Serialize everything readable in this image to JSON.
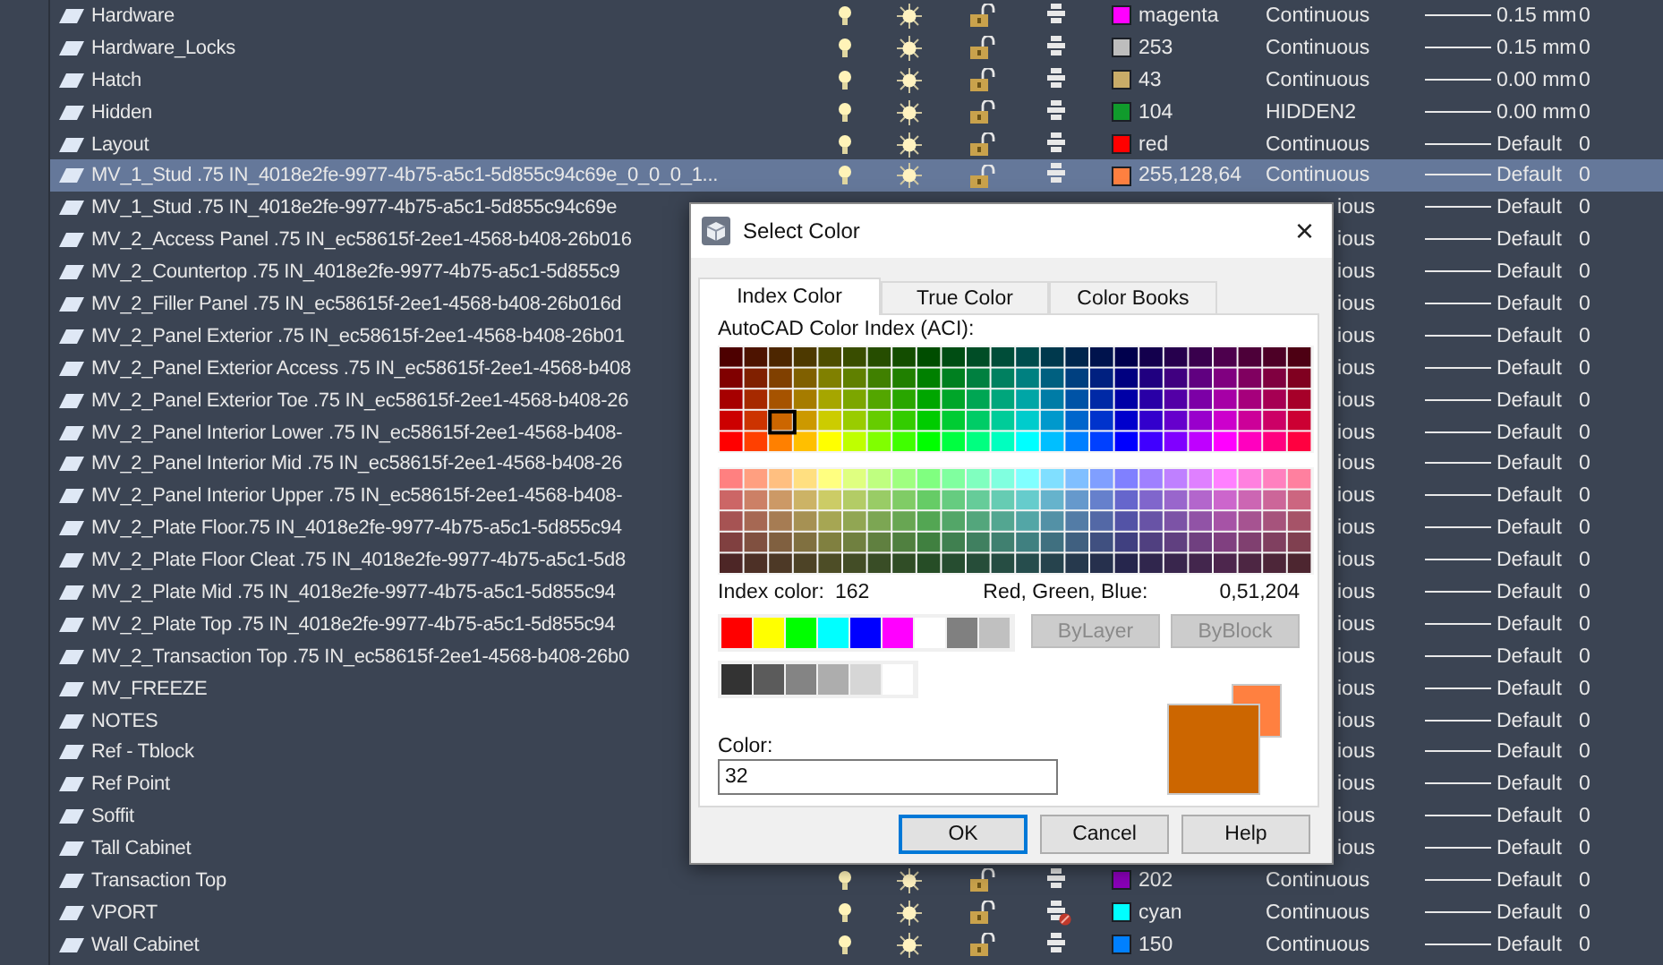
{
  "layers": [
    {
      "kind": "full",
      "name": "Hardware",
      "on": true,
      "frozen": false,
      "locked": false,
      "plot": true,
      "color": "#ff00ff",
      "color_name": "magenta",
      "linetype": "Continuous",
      "lineweight": "0.15 mm",
      "transparency": "0",
      "selected": false
    },
    {
      "kind": "full",
      "name": "Hardware_Locks",
      "on": true,
      "frozen": false,
      "locked": false,
      "plot": true,
      "color": "#bdbdbd",
      "color_name": "253",
      "linetype": "Continuous",
      "lineweight": "0.15 mm",
      "transparency": "0",
      "selected": false
    },
    {
      "kind": "full",
      "name": "Hatch",
      "on": true,
      "frozen": false,
      "locked": false,
      "plot": true,
      "color": "#c9ac68",
      "color_name": "43",
      "linetype": "Continuous",
      "lineweight": "0.00 mm",
      "transparency": "0",
      "selected": false
    },
    {
      "kind": "full",
      "name": "Hidden",
      "on": true,
      "frozen": false,
      "locked": false,
      "plot": true,
      "color": "#109b2c",
      "color_name": "104",
      "linetype": "HIDDEN2",
      "lineweight": "0.00 mm",
      "transparency": "0",
      "selected": false
    },
    {
      "kind": "full",
      "name": "Layout",
      "on": true,
      "frozen": false,
      "locked": false,
      "plot": true,
      "color": "#ff0000",
      "color_name": "red",
      "linetype": "Continuous",
      "lineweight": "Default",
      "transparency": "0",
      "selected": false
    },
    {
      "kind": "full",
      "name": "MV_1_Stud .75 IN_4018e2fe-9977-4b75-a5c1-5d855c94c69e_0_0_0_1...",
      "on": true,
      "frozen": false,
      "locked": false,
      "plot": true,
      "color": "#ff8040",
      "color_name": "255,128,64",
      "linetype": "Continuous",
      "lineweight": "Default",
      "transparency": "0",
      "selected": true
    },
    {
      "kind": "covered",
      "name": "MV_1_Stud .75 IN_4018e2fe-9977-4b75-a5c1-5d855c94c69e",
      "linetype": "ious",
      "lineweight": "Default",
      "transparency": "0"
    },
    {
      "kind": "covered",
      "name": "MV_2_Access Panel .75 IN_ec58615f-2ee1-4568-b408-26b016",
      "linetype": "ious",
      "lineweight": "Default",
      "transparency": "0"
    },
    {
      "kind": "covered",
      "name": "MV_2_Countertop .75 IN_4018e2fe-9977-4b75-a5c1-5d855c9",
      "linetype": "ious",
      "lineweight": "Default",
      "transparency": "0"
    },
    {
      "kind": "covered",
      "name": "MV_2_Filler Panel .75 IN_ec58615f-2ee1-4568-b408-26b016d",
      "linetype": "ious",
      "lineweight": "Default",
      "transparency": "0"
    },
    {
      "kind": "covered",
      "name": "MV_2_Panel Exterior .75 IN_ec58615f-2ee1-4568-b408-26b01",
      "linetype": "ious",
      "lineweight": "Default",
      "transparency": "0"
    },
    {
      "kind": "covered",
      "name": "MV_2_Panel Exterior Access .75 IN_ec58615f-2ee1-4568-b408",
      "linetype": "ious",
      "lineweight": "Default",
      "transparency": "0"
    },
    {
      "kind": "covered",
      "name": "MV_2_Panel Exterior Toe .75 IN_ec58615f-2ee1-4568-b408-26",
      "linetype": "ious",
      "lineweight": "Default",
      "transparency": "0"
    },
    {
      "kind": "covered",
      "name": "MV_2_Panel Interior Lower .75 IN_ec58615f-2ee1-4568-b408-",
      "linetype": "ious",
      "lineweight": "Default",
      "transparency": "0"
    },
    {
      "kind": "covered",
      "name": "MV_2_Panel Interior Mid .75 IN_ec58615f-2ee1-4568-b408-26",
      "linetype": "ious",
      "lineweight": "Default",
      "transparency": "0"
    },
    {
      "kind": "covered",
      "name": "MV_2_Panel Interior Upper .75 IN_ec58615f-2ee1-4568-b408-",
      "linetype": "ious",
      "lineweight": "Default",
      "transparency": "0"
    },
    {
      "kind": "covered",
      "name": "MV_2_Plate Floor.75 IN_4018e2fe-9977-4b75-a5c1-5d855c94",
      "linetype": "ious",
      "lineweight": "Default",
      "transparency": "0"
    },
    {
      "kind": "covered",
      "name": "MV_2_Plate Floor Cleat .75 IN_4018e2fe-9977-4b75-a5c1-5d8",
      "linetype": "ious",
      "lineweight": "Default",
      "transparency": "0"
    },
    {
      "kind": "covered",
      "name": "MV_2_Plate Mid .75 IN_4018e2fe-9977-4b75-a5c1-5d855c94",
      "linetype": "ious",
      "lineweight": "Default",
      "transparency": "0"
    },
    {
      "kind": "covered",
      "name": "MV_2_Plate Top .75 IN_4018e2fe-9977-4b75-a5c1-5d855c94",
      "linetype": "ious",
      "lineweight": "Default",
      "transparency": "0"
    },
    {
      "kind": "covered",
      "name": "MV_2_Transaction Top .75 IN_ec58615f-2ee1-4568-b408-26b0",
      "linetype": "ious",
      "lineweight": "Default",
      "transparency": "0"
    },
    {
      "kind": "covered",
      "name": "MV_FREEZE",
      "linetype": "ious",
      "lineweight": "Default",
      "transparency": "0"
    },
    {
      "kind": "covered",
      "name": "NOTES",
      "linetype": "ious",
      "lineweight": "Default",
      "transparency": "0"
    },
    {
      "kind": "covered",
      "name": "Ref - Tblock",
      "linetype": "ious",
      "lineweight": "Default",
      "transparency": "0"
    },
    {
      "kind": "covered",
      "name": "Ref Point",
      "linetype": "ious",
      "lineweight": "Default",
      "transparency": "0"
    },
    {
      "kind": "covered",
      "name": "Soffit",
      "linetype": "ious",
      "lineweight": "Default",
      "transparency": "0"
    },
    {
      "kind": "covered",
      "name": "Tall Cabinet",
      "linetype": "ious",
      "lineweight": "Default",
      "transparency": "0"
    },
    {
      "kind": "full",
      "name": "Transaction Top",
      "on": true,
      "frozen": false,
      "locked": false,
      "plot": true,
      "color": "#8a00b8",
      "color_name": "202",
      "linetype": "Continuous",
      "lineweight": "Default",
      "transparency": "0",
      "selected": false
    },
    {
      "kind": "full",
      "name": "VPORT",
      "on": true,
      "frozen": false,
      "locked": false,
      "plot": false,
      "color": "#00ffff",
      "color_name": "cyan",
      "linetype": "Continuous",
      "lineweight": "Default",
      "transparency": "0",
      "selected": false
    },
    {
      "kind": "full",
      "name": "Wall Cabinet",
      "on": true,
      "frozen": false,
      "locked": false,
      "plot": true,
      "color": "#0080ff",
      "color_name": "150",
      "linetype": "Continuous",
      "lineweight": "Default",
      "transparency": "0",
      "selected": false
    }
  ],
  "dialog": {
    "title": "Select Color",
    "close": "×",
    "tabs": [
      {
        "label": "Index Color",
        "selected": true
      },
      {
        "label": "True Color",
        "selected": false
      },
      {
        "label": "Color Books",
        "selected": false
      }
    ],
    "palette": {
      "label": "AutoCAD Color Index (ACI):"
    },
    "index_color": {
      "label": "Index color:",
      "value": "162"
    },
    "rgb": {
      "label": "Red, Green, Blue:",
      "value": "0,51,204"
    },
    "standard_colors": [
      {
        "color": "#ff0000"
      },
      {
        "color": "#ffff00"
      },
      {
        "color": "#00ff00"
      },
      {
        "color": "#00ffff"
      },
      {
        "color": "#0000ff"
      },
      {
        "color": "#ff00ff"
      },
      {
        "color": "#ffffff"
      },
      {
        "color": "#808080"
      },
      {
        "color": "#c0c0c0"
      }
    ],
    "gray_colors": [
      {
        "color": "#333333"
      },
      {
        "color": "#5b5b5b"
      },
      {
        "color": "#848484"
      },
      {
        "color": "#adadad"
      },
      {
        "color": "#d6d6d6"
      },
      {
        "color": "#ffffff"
      }
    ],
    "by_buttons": [
      {
        "label": "ByLayer",
        "disabled": true
      },
      {
        "label": "ByBlock",
        "disabled": true
      }
    ],
    "color_field": {
      "label": "Color:",
      "value": "32"
    },
    "preview": [
      {
        "kind": "old",
        "color": "#ff8040"
      },
      {
        "kind": "new",
        "color": "#cc6600"
      }
    ],
    "buttons": [
      {
        "label": "OK",
        "default": true
      },
      {
        "label": "Cancel",
        "default": false
      },
      {
        "label": "Help",
        "default": false
      }
    ]
  }
}
